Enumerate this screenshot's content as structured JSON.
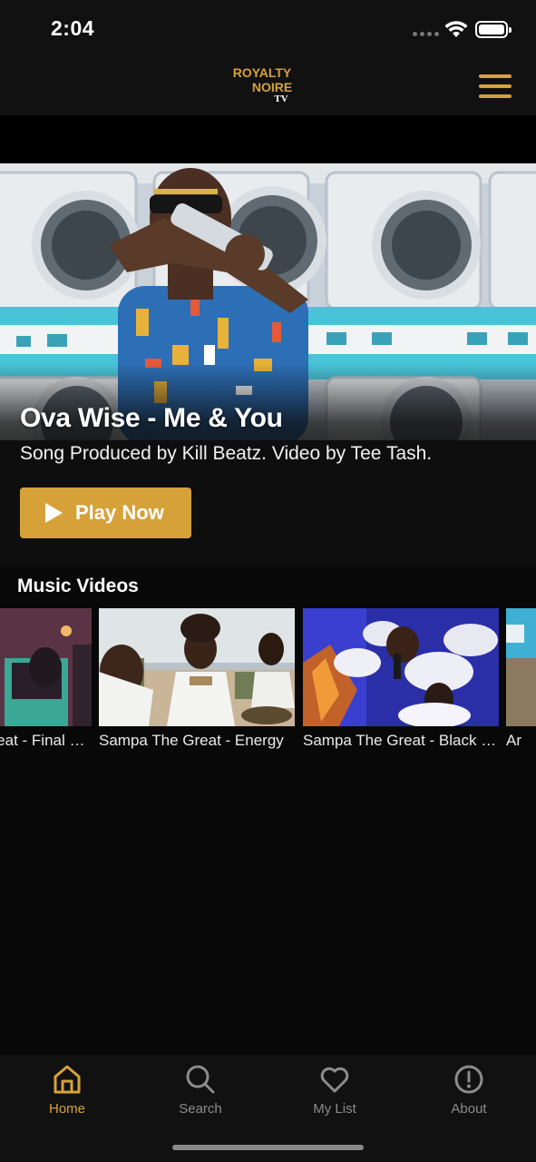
{
  "status_bar": {
    "time": "2:04"
  },
  "header": {
    "logo_line1": "ROYALTY",
    "logo_line2": "NOIRE",
    "logo_line3": "TV",
    "menu_icon": "hamburger-menu-icon"
  },
  "hero": {
    "title": "Ova Wise - Me & You",
    "subtitle": "Song Produced by Kill Beatz. Video by Tee Tash.",
    "play_label": "Play Now"
  },
  "music_videos": {
    "section_title": "Music Videos",
    "items": [
      {
        "title": "Sampa The Great - Final Form"
      },
      {
        "title": "Sampa The Great - Energy"
      },
      {
        "title": "Sampa The Great - Black Girl Magik"
      },
      {
        "title": "Ar"
      }
    ]
  },
  "tab_bar": {
    "tabs": [
      {
        "label": "Home",
        "icon": "home-icon",
        "active": true
      },
      {
        "label": "Search",
        "icon": "search-icon",
        "active": false
      },
      {
        "label": "My List",
        "icon": "heart-icon",
        "active": false
      },
      {
        "label": "About",
        "icon": "info-icon",
        "active": false
      }
    ]
  },
  "colors": {
    "accent": "#d7a13a",
    "background": "#080808",
    "bar": "#111111"
  }
}
